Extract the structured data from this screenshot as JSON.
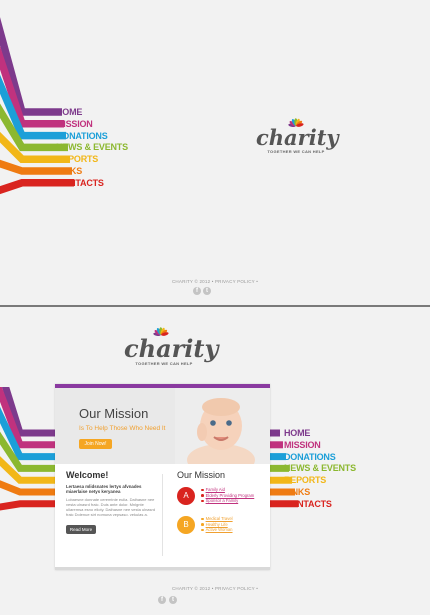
{
  "nav": [
    {
      "label": "HOME",
      "color": "#7d3a8c"
    },
    {
      "label": "MISSION",
      "color": "#c0327e"
    },
    {
      "label": "DONATIONS",
      "color": "#1c9fd8"
    },
    {
      "label": "NEWS & EVENTS",
      "color": "#8cb830"
    },
    {
      "label": "REPORTS",
      "color": "#f2b718"
    },
    {
      "label": "LINKS",
      "color": "#ef7b12"
    },
    {
      "label": "CONTACTS",
      "color": "#d9241f"
    }
  ],
  "brand": {
    "name": "charity",
    "tagline": "TOGETHER WE CAN HELP"
  },
  "footer": {
    "text": "CHARITY © 2012 • PRIVACY POLICY •",
    "facebook": "f",
    "twitter": "t"
  },
  "hero": {
    "title": "Our Mission",
    "subtitle": "Is To Help Those Who Need It",
    "button": "Join Now!"
  },
  "welcome": {
    "title": "Welcome!",
    "lead": "Lertaesa mlidsnates lertys afvnades miaerlaise netys keryanea",
    "text": "Lobaesne donnate ceremtnie eulia. Daihasne nee vesta ulnasrd fraic. Duis ante dolor. Mnlgnte ullaremsa esno elioty. Daihasne nee vesta ulnasrd fraic Dolenue sirt nomuna vepsaso. vekulas a.",
    "button": "Read More"
  },
  "mission": {
    "title": "Our Mission",
    "groups": [
      {
        "letter": "A",
        "color": "#d9241f",
        "items": [
          "Family Aid",
          "Elderly Providing Program",
          "Sponsor a Family"
        ]
      },
      {
        "letter": "B",
        "color": "#f5a623",
        "items": [
          "Medical Travel",
          "Healthy Life",
          "Active Woman"
        ]
      }
    ]
  }
}
